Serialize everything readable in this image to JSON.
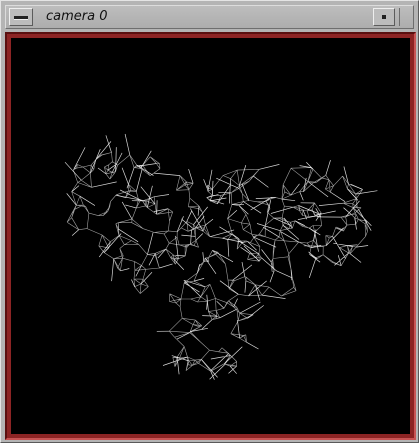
{
  "window": {
    "title": "camera 0"
  },
  "titlebar": {
    "menu_icon": "window-menu-icon",
    "minimize_icon": "minimize-icon"
  },
  "viewport": {
    "background": "#000000",
    "frame_color": "#8c2424",
    "mesh_color": "#d8d8d8",
    "content": "wireframe-mesh"
  }
}
